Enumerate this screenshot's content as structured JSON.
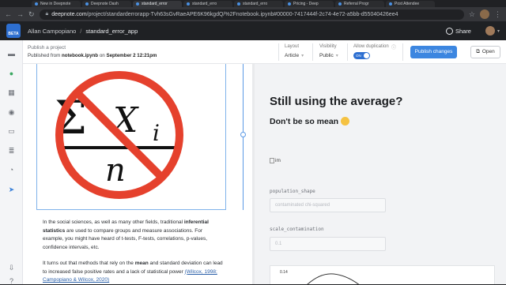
{
  "browser": {
    "tabs": [
      {
        "label": "New in Deepnote"
      },
      {
        "label": "Deepnote Dash"
      },
      {
        "label": "standard_error"
      },
      {
        "label": "standard_erro"
      },
      {
        "label": "standard_erro"
      },
      {
        "label": "Pricing - Deep"
      },
      {
        "label": "Referral Progr"
      },
      {
        "label": "Post Attendee"
      }
    ],
    "url_domain": "deepnote.com",
    "url_path": "/project/standarderrorapp-Tvh63sGvRaeAPE6K96kgdQ/%2Fnotebook.ipynb#00000-7417444f-2c74-4e72-a5bb-d55040426ee4"
  },
  "header": {
    "logo_text": "BETA",
    "user": "Allan Campopiano",
    "separator": "/",
    "project": "standard_error_app",
    "share_label": "Share"
  },
  "publish": {
    "title": "Publish a project",
    "sub_prefix": "Published from",
    "notebook": "notebook.ipynb",
    "sub_mid": "on",
    "date": "September 2 12:21pm",
    "layout_label": "Layout",
    "layout_value": "Article",
    "visibility_label": "Visibility",
    "visibility_value": "Public",
    "duplication_label": "Allow duplication",
    "toggle_value": "ON",
    "publish_button": "Publish changes",
    "open_button": "Open"
  },
  "doc": {
    "formula_sum": "Σ",
    "formula_x": "X",
    "formula_i": "i",
    "formula_n": "n",
    "p1_a": "In the social sciences, as well as many other fields, traditional",
    "p1_b": "inferential statistics",
    "p1_c": "are used to compare groups and measure associations. For example, you might have heard of t-tests, F-tests, correlations, p-values, confidence intervals, etc.",
    "p2_a": "It turns out that methods that rely on the",
    "p2_mean": "mean",
    "p2_b": "and standard deviation can lead to increased false positive rates and a lack of statistical power",
    "p2_cite": "(Wilcox, 1998; Campopiano & Wilcox, 2020)"
  },
  "preview": {
    "title": "Still using the average?",
    "subtitle": "Don't be so mean",
    "img_alt": "im",
    "field1_label": "population_shape",
    "field1_value": "contaminated chi-squared",
    "field2_label": "scale_contamination",
    "field2_value": "0.1",
    "plot_tick": "0.14"
  },
  "colors": {
    "accent": "#3c86e0",
    "no_sign": "#e5412d"
  }
}
